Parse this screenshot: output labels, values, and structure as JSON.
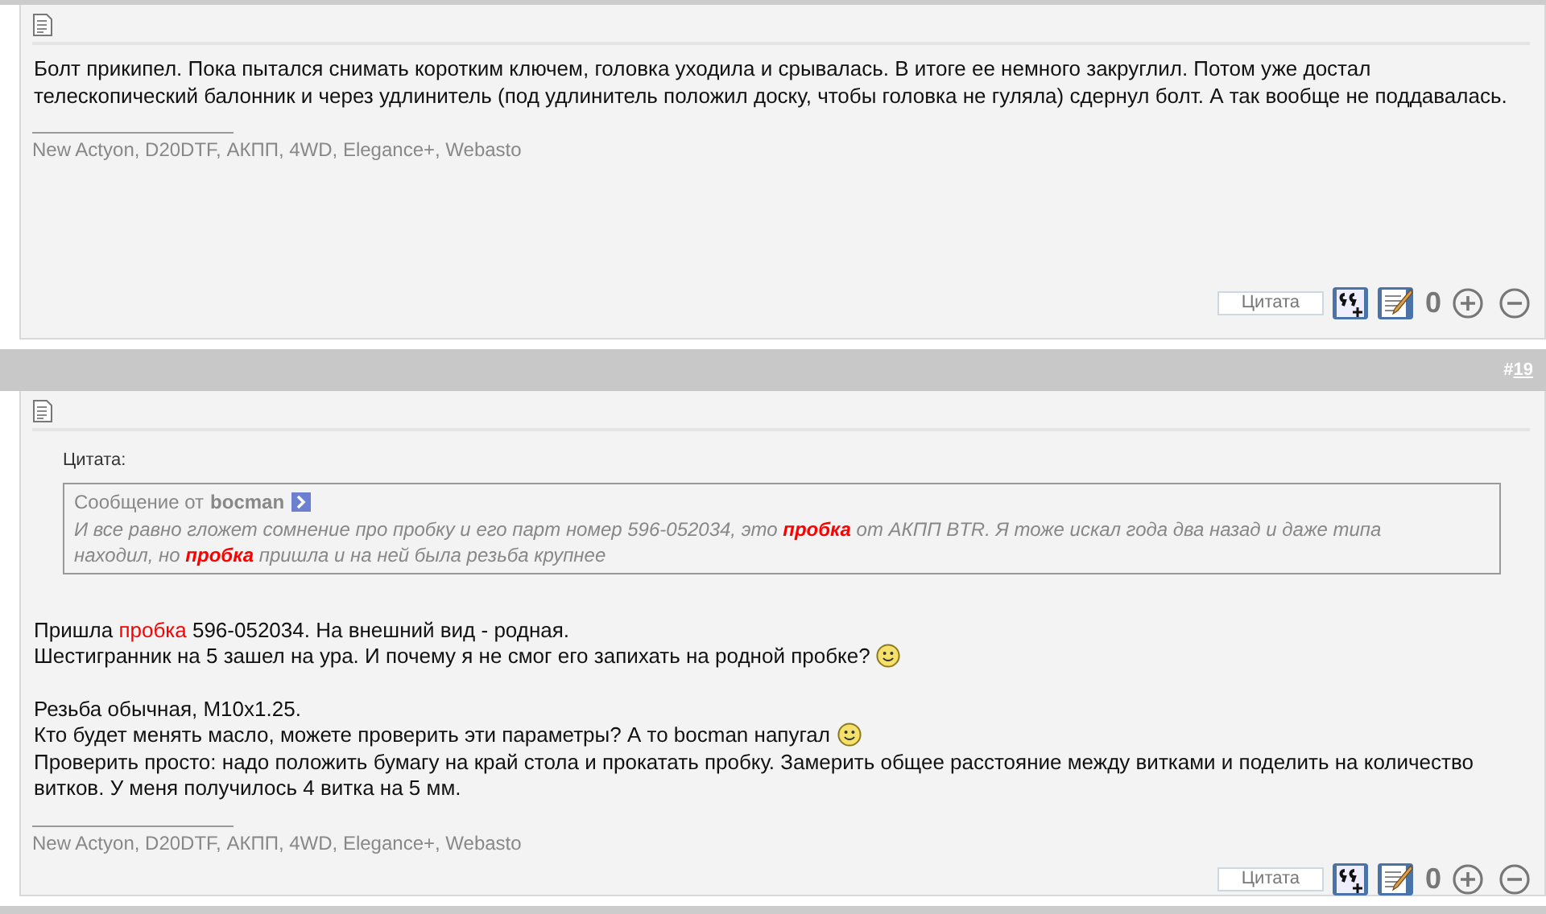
{
  "posts": [
    {
      "blocks": [
        [
          {
            "segments": [
              {
                "text": "Болт прикипел. Пока пытался снимать коротким ключем, головка уходила и срывалась. В итоге ее немного закруглил. Потом уже достал телескопический балонник и через удлинитель (под удлинитель положил доску, чтобы головка не гуляла) сдернул болт. А так вообще не поддавалась.",
                "highlight": false
              }
            ],
            "smiley": false
          }
        ]
      ],
      "signature": "New Actyon, D20DTF, АКПП, 4WD, Elegance+, Webasto",
      "quote_button": "Цитата",
      "rating": "0"
    },
    {
      "number_prefix": "#",
      "number": "19",
      "quote": {
        "label": "Цитата:",
        "author_prefix": "Сообщение от",
        "author": "bocman",
        "text": [
          {
            "text": "И все равно гложет сомнение про пробку и его парт номер 596-052034, это ",
            "highlight": false
          },
          {
            "text": "пробка",
            "highlight": true
          },
          {
            "text": " от АКПП BTR. Я тоже искал года два назад и даже типа находил, но ",
            "highlight": false
          },
          {
            "text": "пробка",
            "highlight": true
          },
          {
            "text": " пришла и на ней была резьба крупнее",
            "highlight": false
          }
        ]
      },
      "blocks": [
        [
          {
            "segments": [
              {
                "text": "Пришла ",
                "highlight": false
              },
              {
                "text": "пробка",
                "highlight": true
              },
              {
                "text": " 596-052034. На внешний вид - родная.",
                "highlight": false
              }
            ],
            "smiley": false
          },
          {
            "segments": [
              {
                "text": "Шестигранник на 5 зашел на ура. И почему я не смог его запихать на родной пробке?",
                "highlight": false
              }
            ],
            "smiley": true
          }
        ],
        [
          {
            "segments": [
              {
                "text": "Резьба обычная, M10x1.25.",
                "highlight": false
              }
            ],
            "smiley": false
          },
          {
            "segments": [
              {
                "text": "Кто будет менять масло, можете проверить эти параметры? А то bocman напугал",
                "highlight": false
              }
            ],
            "smiley": true
          },
          {
            "segments": [
              {
                "text": "Проверить просто: надо положить бумагу на край стола и прокатать пробку. Замерить общее расстояние между витками и поделить на количество витков. У меня получилось 4 витка на 5 мм.",
                "highlight": false
              }
            ],
            "smiley": false
          }
        ]
      ],
      "signature": "New Actyon, D20DTF, АКПП, 4WD, Elegance+, Webasto",
      "quote_button": "Цитата",
      "rating": "0"
    }
  ]
}
